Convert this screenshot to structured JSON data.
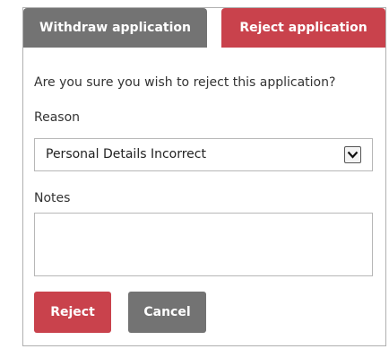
{
  "tabs": {
    "withdraw_label": "Withdraw application",
    "reject_label": "Reject application",
    "active": "reject"
  },
  "form": {
    "question": "Are you sure you wish to reject this application?",
    "reason_label": "Reason",
    "reason_value": "Personal Details Incorrect",
    "dropdown_icon": "chevron-down-icon",
    "notes_label": "Notes",
    "notes_value": ""
  },
  "buttons": {
    "reject_label": "Reject",
    "cancel_label": "Cancel"
  },
  "colors": {
    "accent": "#c9424c",
    "secondary": "#737373",
    "border": "#b7b7b7"
  }
}
